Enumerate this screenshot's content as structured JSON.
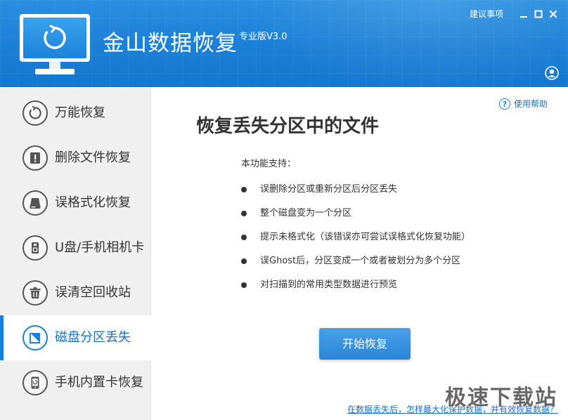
{
  "header": {
    "app_title": "金山数据恢复",
    "edition": "专业版V3.0",
    "feedback_label": "建议事项"
  },
  "sidebar": {
    "items": [
      {
        "label": "万能恢复",
        "icon": "refresh-icon",
        "active": false
      },
      {
        "label": "删除文件恢复",
        "icon": "exclamation-icon",
        "active": false
      },
      {
        "label": "误格式化恢复",
        "icon": "hard-disk-icon",
        "active": false
      },
      {
        "label": "U盘/手机相机卡",
        "icon": "usb-drive-icon",
        "active": false
      },
      {
        "label": "误清空回收站",
        "icon": "trash-icon",
        "active": false
      },
      {
        "label": "磁盘分区丢失",
        "icon": "partition-icon",
        "active": true
      },
      {
        "label": "手机内置卡恢复",
        "icon": "phone-icon",
        "active": false
      }
    ]
  },
  "main": {
    "help_label": "使用帮助",
    "title": "恢复丢失分区中的文件",
    "support_heading": "本功能支持：",
    "features": [
      "误删除分区或重新分区后分区丢失",
      "整个磁盘变为一个分区",
      "提示未格式化（该错误亦可尝试误格式化恢复功能）",
      "误Ghost后，分区变成一个或者被划分为多个分区",
      "对扫描到的常用类型数据进行预览"
    ],
    "start_button": "开始恢复",
    "bottom_link": "在数据丢失后，怎样最大化保护数据，并有效恢复数据？"
  },
  "watermark": "极速下载站",
  "colors": {
    "header_blue": "#1a7fd6",
    "accent": "#1a6fc0",
    "button_blue": "#2b86d8",
    "sidebar_bg": "#f0f0f0"
  }
}
